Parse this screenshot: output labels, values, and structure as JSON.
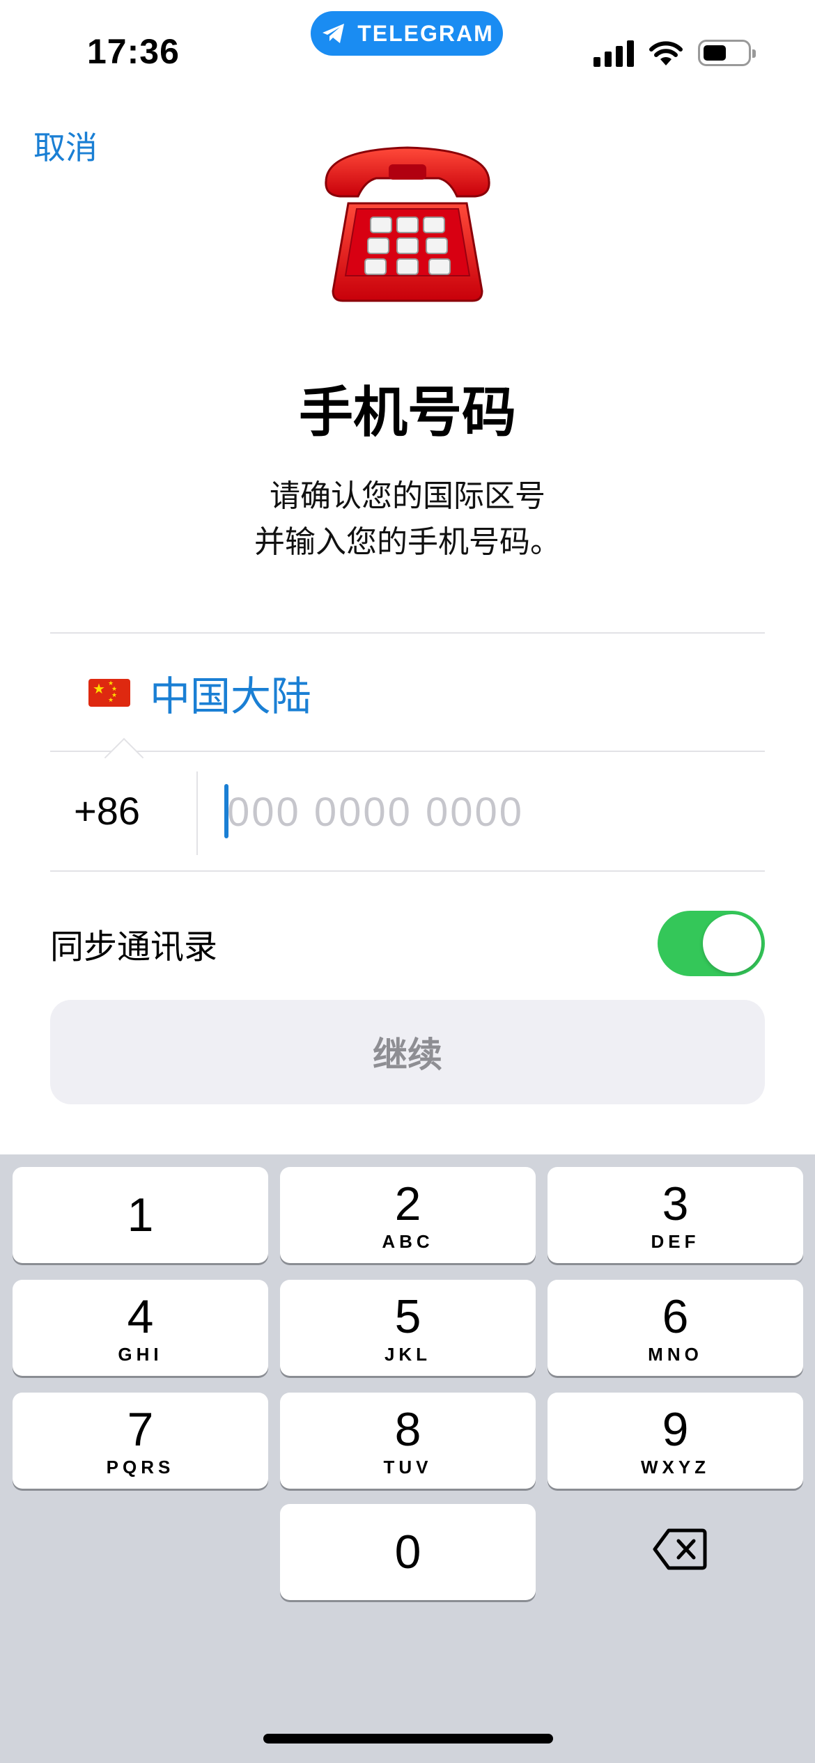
{
  "status_bar": {
    "time": "17:36",
    "app_pill": "TELEGRAM",
    "icons": [
      "cellular-signal-icon",
      "wifi-icon",
      "battery-icon"
    ]
  },
  "header": {
    "cancel_label": "取消",
    "illustration": "telephone-icon"
  },
  "title": "手机号码",
  "subtitle_lines": [
    "请确认您的国际区号",
    "并输入您的手机号码。"
  ],
  "country": {
    "flag": "china-flag-icon",
    "name": "中国大陆"
  },
  "phone": {
    "code": "+86",
    "value": "",
    "placeholder": "000 0000 0000"
  },
  "sync_contacts": {
    "label": "同步通讯录",
    "enabled": true
  },
  "continue_label": "继续",
  "keypad": {
    "keys": [
      {
        "digit": "1",
        "letters": ""
      },
      {
        "digit": "2",
        "letters": "ABC"
      },
      {
        "digit": "3",
        "letters": "DEF"
      },
      {
        "digit": "4",
        "letters": "GHI"
      },
      {
        "digit": "5",
        "letters": "JKL"
      },
      {
        "digit": "6",
        "letters": "MNO"
      },
      {
        "digit": "7",
        "letters": "PQRS"
      },
      {
        "digit": "8",
        "letters": "TUV"
      },
      {
        "digit": "9",
        "letters": "WXYZ"
      },
      {
        "digit": "0",
        "letters": ""
      }
    ],
    "backspace_icon": "backspace-icon"
  },
  "colors": {
    "accent": "#1a7fd4",
    "pill": "#1a8cf2",
    "toggle_on": "#34c759",
    "keypad_bg": "#d1d4db",
    "button_disabled_bg": "#efeff4",
    "button_disabled_text": "#8e8e93"
  }
}
